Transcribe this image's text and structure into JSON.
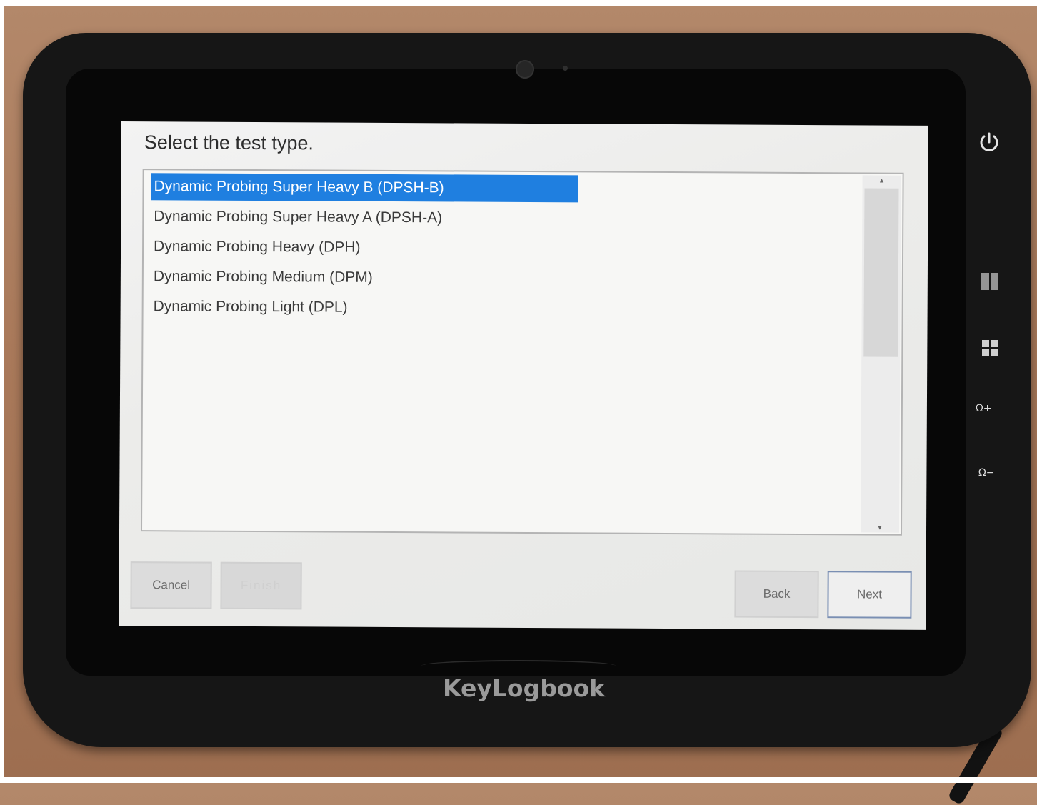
{
  "device": {
    "brand": "KeyLogbook",
    "side_buttons": {
      "power_icon": "power-icon",
      "grid_icon": "grid-icon",
      "windows_icon": "windows-icon",
      "volume_up": "Ω+",
      "volume_down": "Ω−"
    }
  },
  "dialog": {
    "prompt": "Select the test type.",
    "test_types": [
      {
        "label": "Dynamic Probing Super Heavy B (DPSH-B)",
        "selected": true
      },
      {
        "label": "Dynamic Probing Super Heavy A (DPSH-A)",
        "selected": false
      },
      {
        "label": "Dynamic Probing Heavy (DPH)",
        "selected": false
      },
      {
        "label": "Dynamic Probing Medium (DPM)",
        "selected": false
      },
      {
        "label": "Dynamic Probing Light (DPL)",
        "selected": false
      }
    ],
    "buttons": {
      "cancel": "Cancel",
      "finish": "Finish",
      "back": "Back",
      "next": "Next"
    }
  },
  "colors": {
    "selection": "#1f7fe0",
    "screen_bg": "#ececea",
    "device_body": "#161616",
    "table": "#a9795a"
  }
}
